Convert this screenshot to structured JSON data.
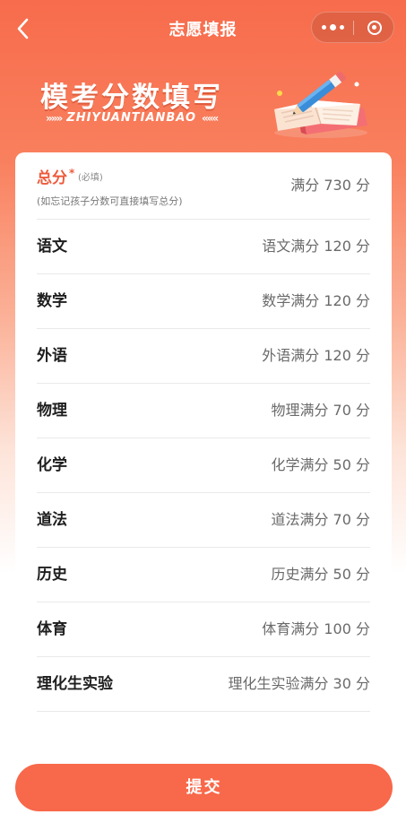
{
  "topbar": {
    "title": "志愿填报"
  },
  "banner": {
    "title": "模考分数填写",
    "subtitle": "ZHIYUANTIANBAO",
    "chevrons_left": "»»»",
    "chevrons_right": "«««"
  },
  "total": {
    "label": "总分",
    "star": "*",
    "required": "(必填)",
    "hint": "(如忘记孩子分数可直接填写总分)",
    "value": "满分 730 分"
  },
  "subjects": [
    {
      "label": "语文",
      "value": "语文满分 120 分"
    },
    {
      "label": "数学",
      "value": "数学满分 120 分"
    },
    {
      "label": "外语",
      "value": "外语满分 120 分"
    },
    {
      "label": "物理",
      "value": "物理满分 70 分"
    },
    {
      "label": "化学",
      "value": "化学满分 50 分"
    },
    {
      "label": "道法",
      "value": "道法满分 70 分"
    },
    {
      "label": "历史",
      "value": "历史满分 50 分"
    },
    {
      "label": "体育",
      "value": "体育满分 100 分"
    },
    {
      "label": "理化生实验",
      "value": "理化生实验满分 30 分"
    }
  ],
  "submit": {
    "label": "提交"
  },
  "colors": {
    "accent": "#f8684a",
    "label_red": "#ee5b3c"
  }
}
